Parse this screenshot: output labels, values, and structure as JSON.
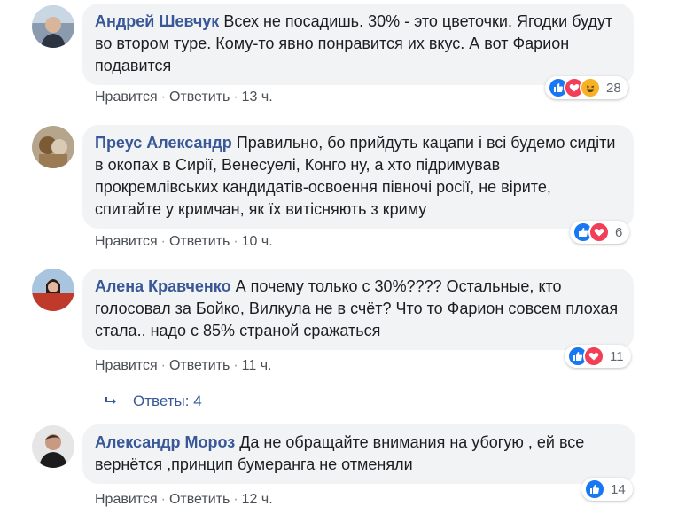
{
  "comments": [
    {
      "author": "Андрей Шевчук",
      "text": "Всех не посадишь. 30% - это цветочки. Ягодки будут во втором туре. Кому-то явно понравится их вкус. А вот Фарион подавится",
      "like": "Нравится",
      "reply": "Ответить",
      "time": "13 ч.",
      "reactions_count": "28",
      "reaction_icons": [
        "like-icon",
        "love-icon",
        "haha-icon"
      ]
    },
    {
      "author": "Преус Александр",
      "text": "Правильно, бо прийдуть кацапи і всі будемо сидіти в окопах в Сирії, Венесуелі, Конго ну, а хто підримував прокремлівських кандидатів-освоення півночі росії, не вірите, спитайте у кримчан, як їх витісняють з криму",
      "like": "Нравится",
      "reply": "Ответить",
      "time": "10 ч.",
      "reactions_count": "6",
      "reaction_icons": [
        "like-icon",
        "love-icon"
      ]
    },
    {
      "author": "Алена Кравченко",
      "text": "А почему только с 30%???? Остальные, кто голосовал за Бойко, Вилкула не в счёт? Что то Фарион совсем плохая стала.. надо с 85% страной сражаться",
      "like": "Нравится",
      "reply": "Ответить",
      "time": "11 ч.",
      "reactions_count": "11",
      "reaction_icons": [
        "like-icon",
        "love-icon"
      ]
    },
    {
      "author": "Александр Мороз",
      "text": "Да не обращайте внимания на убогую , ей все вернётся ,принцип бумеранга не отменяли",
      "like": "Нравится",
      "reply": "Ответить",
      "time": "12 ч.",
      "reactions_count": "14",
      "reaction_icons": [
        "like-icon"
      ]
    }
  ],
  "replies_link": "Ответы: 4",
  "colors": {
    "author": "#385898",
    "bubble": "#f2f3f5",
    "like": "#1877f2",
    "love": "#f33e58",
    "haha": "#f7b125"
  }
}
